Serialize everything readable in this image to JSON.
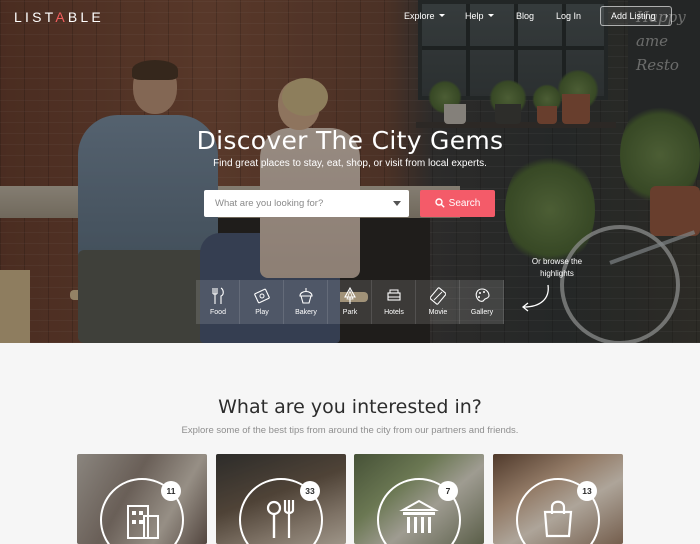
{
  "header": {
    "logo_prefix": "LIST",
    "logo_accent": "A",
    "logo_suffix": "BLE",
    "nav": [
      {
        "label": "Explore",
        "has_dropdown": true
      },
      {
        "label": "Help",
        "has_dropdown": true
      },
      {
        "label": "Blog",
        "has_dropdown": false
      },
      {
        "label": "Log In",
        "has_dropdown": false
      }
    ],
    "add_listing_label": "Add Listing",
    "add_listing_icon": "chevron-right-icon"
  },
  "hero": {
    "title": "Discover The City Gems",
    "subtitle": "Find great places to stay, eat, shop, or visit from local experts.",
    "search": {
      "placeholder": "What are you looking for?",
      "button_label": "Search",
      "button_icon": "search-icon"
    },
    "browse_hint": [
      "Or browse the",
      "highlights"
    ],
    "chalkboard_text": [
      "Happy",
      "ame",
      "Resto"
    ],
    "categories": [
      {
        "label": "Food",
        "icon": "food-icon"
      },
      {
        "label": "Play",
        "icon": "ticket-icon"
      },
      {
        "label": "Bakery",
        "icon": "cupcake-icon"
      },
      {
        "label": "Park",
        "icon": "tree-icon"
      },
      {
        "label": "Hotels",
        "icon": "bed-icon"
      },
      {
        "label": "Movie",
        "icon": "film-icon"
      },
      {
        "label": "Gallery",
        "icon": "palette-icon"
      }
    ]
  },
  "interests": {
    "title": "What are you interested in?",
    "subtitle": "Explore some of the best tips from around the city from our partners and friends.",
    "cards": [
      {
        "count": "11",
        "icon": "building-icon"
      },
      {
        "count": "33",
        "icon": "cutlery-icon"
      },
      {
        "count": "7",
        "icon": "museum-icon"
      },
      {
        "count": "13",
        "icon": "shopping-bag-icon"
      }
    ]
  },
  "colors": {
    "accent": "#f45b69",
    "logo_accent": "#f25e5e",
    "section_bg": "#f6f6f6"
  }
}
